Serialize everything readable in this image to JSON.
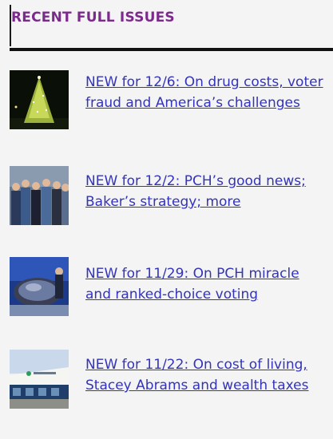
{
  "widget": {
    "title": "RECENT FULL ISSUES",
    "items": [
      {
        "link_text": "NEW for 12/6: On drug costs, voter fraud and America’s challenges",
        "thumb": "christmas-tree-photo"
      },
      {
        "link_text": "NEW for 12/2: PCH’s good news; Baker’s strategy; more",
        "thumb": "group-photo"
      },
      {
        "link_text": "NEW for 11/29: On PCH miracle and ranked-choice voting",
        "thumb": "sculpture-photo"
      },
      {
        "link_text": "NEW for 11/22: On cost of living, Stacey Abrams and wealth taxes",
        "thumb": "building-photo"
      }
    ]
  },
  "colors": {
    "title": "#7b2a8c",
    "link": "#3333bb",
    "background": "#f4f4f4"
  }
}
